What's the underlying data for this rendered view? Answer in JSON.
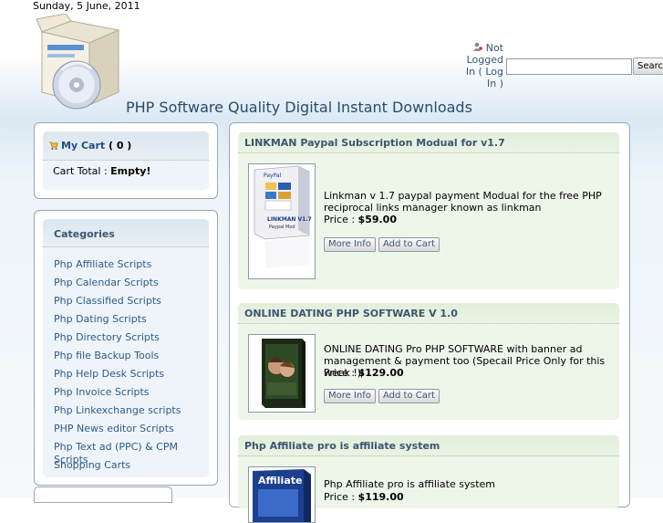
{
  "header": {
    "date": "Sunday, 5 June, 2011",
    "site_title": "PHP Software Quality Digital Instant Downloads"
  },
  "login": {
    "status_prefix": "Not Logged In (",
    "login_link": "Log In",
    "status_suffix": ")",
    "search_value": "",
    "search_button": "Search"
  },
  "cart": {
    "title": "My Cart",
    "count_text": "( 0 )",
    "total_label": "Cart Total :",
    "total_value": "Empty!"
  },
  "categories": {
    "title": "Categories",
    "items": [
      "Php Affiliate Scripts",
      "Php Calendar Scripts",
      "Php Classified Scripts",
      "Php Dating Scripts",
      "Php Directory Scripts",
      "Php file Backup Tools",
      "Php Help Desk Scripts",
      "Php Invoice Scripts",
      "Php Linkexchange scripts",
      "PHP News editor Scripts",
      "Php Text ad (PPC) & CPM Scripts",
      "Shopping Carts"
    ]
  },
  "products": [
    {
      "title": "LINKMAN Paypal Subscription Modual for v1.7",
      "description": "Linkman v 1.7 paypal payment Modual for the free PHP reciprocal links manager known as linkman",
      "price_label": "Price :",
      "price": "$59.00",
      "more_info": "More Info",
      "add_to_cart": "Add to Cart",
      "box_label": "LINKMAN V1.7",
      "box_sub": "Paypal Mod"
    },
    {
      "title": "ONLINE DATING PHP SOFTWARE V 1.0",
      "description": "ONLINE DATING Pro PHP SOFTWARE with banner ad management & payment too (Specail Price Only for this week !)l",
      "price_label": "Price :",
      "price": "$129.00",
      "more_info": "More Info",
      "add_to_cart": "Add to Cart"
    },
    {
      "title": "Php Affiliate pro is affiliate system",
      "description": "Php Affiliate pro is affiliate system",
      "price_label": "Price :",
      "price": "$119.00",
      "box_label": "Affiliate"
    }
  ],
  "colors": {
    "link": "#2d5b8a",
    "heading": "#3a5670",
    "cart_title": "#1e4f87"
  }
}
